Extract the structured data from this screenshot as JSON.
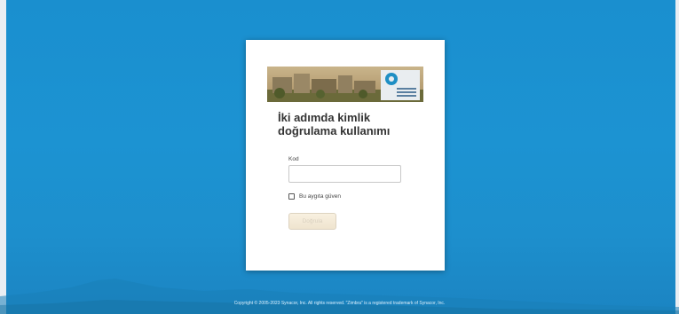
{
  "login": {
    "banner_icon": "university-campus-banner",
    "title": "İki adımda kimlik doğrulama kullanımı",
    "code_label": "Kod",
    "code_value": "",
    "code_placeholder": "",
    "trust_device_label": "Bu aygıta güven",
    "trust_device_checked": false,
    "submit_label": "Doğrula"
  },
  "footer": {
    "copyright": "Copyright © 2005-2023 Synacor, Inc. All rights reserved. \"Zimbra\" is a registered trademark of Synacor, Inc."
  },
  "colors": {
    "background": "#1c92d1",
    "card": "#ffffff",
    "button": "#f4ead7"
  }
}
